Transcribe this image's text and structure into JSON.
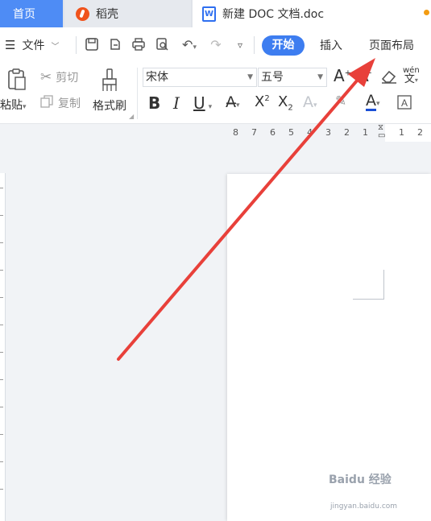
{
  "tabs": {
    "home": "首页",
    "daoke": "稻壳",
    "document": "新建 DOC 文档.doc"
  },
  "menu": {
    "file": "文件",
    "start": "开始",
    "insert": "插入",
    "page_layout": "页面布局"
  },
  "ribbon": {
    "paste": "粘贴",
    "cut": "剪切",
    "copy": "复制",
    "format_painter": "格式刷",
    "font_name": "宋体",
    "font_size": "五号",
    "bold": "B",
    "italic": "I",
    "underline": "U",
    "phonetic": "wén"
  },
  "ruler": {
    "ticks": [
      "8",
      "7",
      "6",
      "5",
      "4",
      "3",
      "2",
      "1",
      "1",
      "2"
    ]
  },
  "watermark": {
    "brand": "Baidu 经验",
    "url": "jingyan.baidu.com"
  },
  "colors": {
    "accent": "#3d7df0",
    "home_tab": "#4e8cf5",
    "arrow": "#e8403a"
  }
}
